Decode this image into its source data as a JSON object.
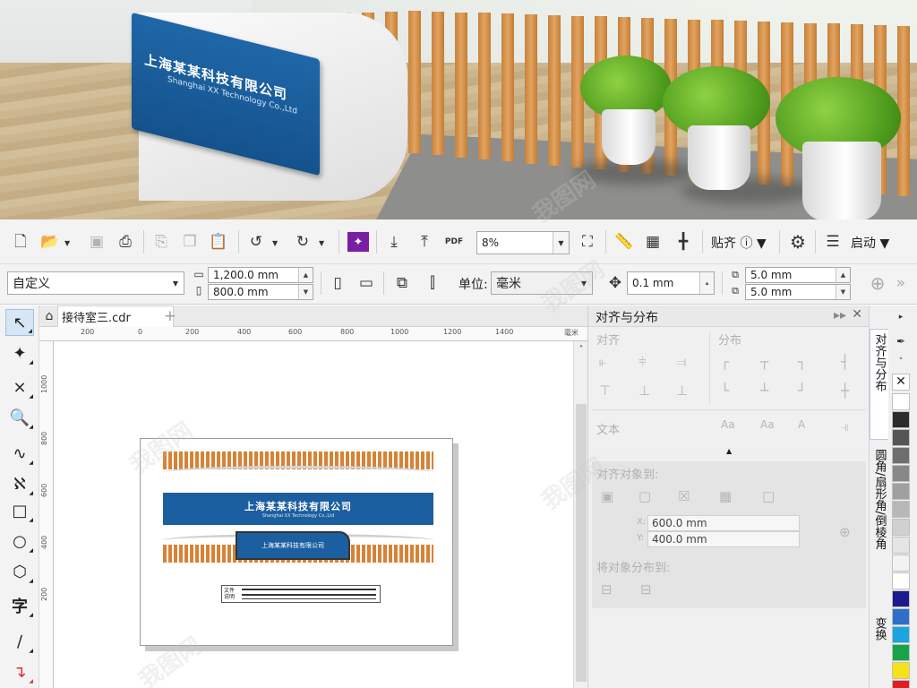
{
  "banner": {
    "sign_text": "上海某某科技有限公司",
    "sign_subtext": "Shanghai XX Technology Co.,Ltd"
  },
  "toolbar": {
    "zoom": "8%",
    "snap_label": "贴齐",
    "launch_label": "启动",
    "pdf_label": "PDF",
    "page_size_preset": "自定义",
    "width": "1,200.0 mm",
    "height": "800.0 mm",
    "units_label": "单位:",
    "units_value": "毫米",
    "nudge": "0.1 mm",
    "dup_x": "5.0 mm",
    "dup_y": "5.0 mm"
  },
  "document": {
    "tab_name": "接待室三.cdr",
    "ruler_h": [
      "200",
      "0",
      "200",
      "400",
      "600",
      "800",
      "1000",
      "1200",
      "1400"
    ],
    "ruler_h_unit": "毫米",
    "ruler_v": [
      "1000",
      "800",
      "600",
      "400",
      "200"
    ]
  },
  "artwork": {
    "company": "上海某某科技有限公司",
    "company_en": "Shanghai XX Technology Co.,Ltd",
    "mini_sign": "上海某某科技有限公司",
    "note_line1": "文件",
    "note_line2": "说明"
  },
  "docker": {
    "title": "对齐与分布",
    "align_label": "对齐",
    "distribute_label": "分布",
    "text_label": "文本",
    "align_to_label": "对齐对象到:",
    "x_label": "X:",
    "x_value": "600.0 mm",
    "y_label": "Y:",
    "y_value": "400.0 mm",
    "distribute_to_label": "将对象分布到:"
  },
  "side_tabs": {
    "tab1": "对齐与分布",
    "tab2": "圆角/扇形角/倒棱角",
    "tab3": "变换"
  },
  "palette": [
    "#ffffff",
    "#2b2b2b",
    "#555555",
    "#6e6e6e",
    "#888888",
    "#a0a0a0",
    "#b8b8b8",
    "#d0d0d0",
    "#e5e5e5",
    "#f2f2f2",
    "#ffffff",
    "#1a1a8c",
    "#2f6fc8",
    "#18a5e0",
    "#18a34a",
    "#f7e21a",
    "#e02020"
  ],
  "watermark": "我图网"
}
